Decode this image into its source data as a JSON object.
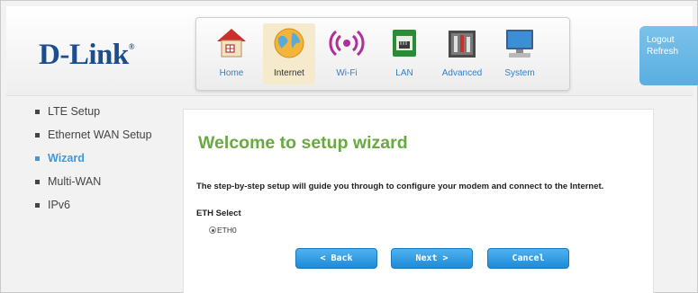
{
  "brand": {
    "logo": "D-Link",
    "reg_mark": "®"
  },
  "nav": {
    "items": [
      {
        "label": "Home",
        "icon": "home-icon"
      },
      {
        "label": "Internet",
        "icon": "globe-icon"
      },
      {
        "label": "Wi-Fi",
        "icon": "wifi-icon"
      },
      {
        "label": "LAN",
        "icon": "lan-icon"
      },
      {
        "label": "Advanced",
        "icon": "toolbox-icon"
      },
      {
        "label": "System",
        "icon": "computer-icon"
      }
    ],
    "active": "Internet"
  },
  "account": {
    "logout": "Logout",
    "refresh": "Refresh"
  },
  "sidebar": {
    "items": [
      {
        "label": "LTE Setup"
      },
      {
        "label": "Ethernet WAN Setup"
      },
      {
        "label": "Wizard"
      },
      {
        "label": "Multi-WAN"
      },
      {
        "label": "IPv6"
      }
    ],
    "active": "Wizard"
  },
  "main": {
    "title": "Welcome to setup wizard",
    "description": "The step-by-step setup will guide you through to configure your modem and connect to the Internet.",
    "eth_select_label": "ETH Select",
    "eth_option": "ETH0",
    "buttons": {
      "back": "< Back",
      "next": "Next >",
      "cancel": "Cancel"
    }
  },
  "colors": {
    "brand_blue": "#1d4d8e",
    "accent_blue": "#3d9ad9",
    "title_green": "#6aa841",
    "button_blue": "#1e8ad8"
  }
}
